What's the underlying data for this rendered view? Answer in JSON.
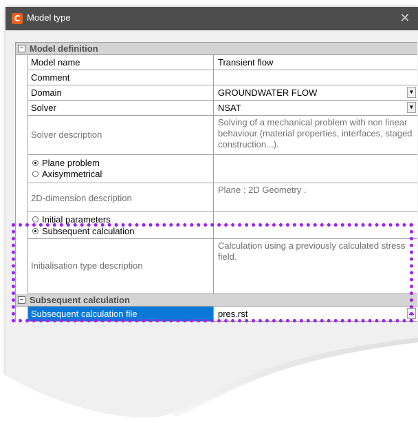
{
  "window": {
    "title": "Model type",
    "app_icon": "app-logo-icon",
    "close_glyph": "✕"
  },
  "grid": {
    "categories": {
      "model_definition": {
        "toggle": "⊟",
        "label": "Model definition"
      },
      "subsequent_calculation": {
        "toggle": "⊟",
        "label": "Subsequent calculation"
      }
    },
    "rows": {
      "model_name": {
        "label": "Model name",
        "value": "Transient flow"
      },
      "comment": {
        "label": "Comment",
        "value": ""
      },
      "domain": {
        "label": "Domain",
        "value": "GROUNDWATER FLOW"
      },
      "solver": {
        "label": "Solver",
        "value": "NSAT"
      },
      "solver_description": {
        "label": "Solver description",
        "value": "Solving of a mechanical problem with non linear  behaviour (material properties, interfaces, staged construction...)."
      },
      "problem_type": {
        "options": [
          "Plane problem",
          "Axisymmetrical"
        ],
        "selected": "Plane problem"
      },
      "dimension_description": {
        "label": "2D-dimension description",
        "value": "Plane : 2D Geometry ."
      },
      "init_type": {
        "options": [
          "Initial parameters",
          "Subsequent calculation"
        ],
        "selected": "Subsequent calculation"
      },
      "init_description": {
        "label": "Initialisation type description",
        "value": "Calculation using a previously calculated stress field."
      },
      "subsequent_file": {
        "label": "Subsequent calculation file",
        "value": "pres.rst"
      }
    }
  },
  "colors": {
    "title_bar": "#4d4d4d",
    "selection": "#0a78d7",
    "highlight_border": "#a020f0",
    "app_icon": "#e8601c"
  }
}
